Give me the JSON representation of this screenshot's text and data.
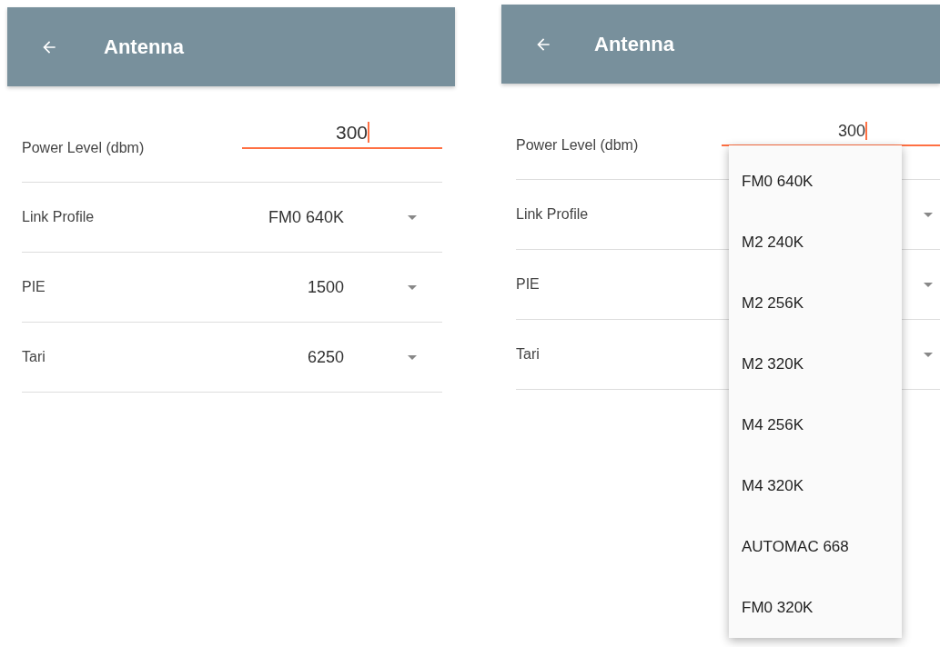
{
  "screens": [
    {
      "title": "Antenna",
      "fields": [
        {
          "kind": "input",
          "label": "Power Level (dbm)",
          "value": "300"
        },
        {
          "kind": "dropdown",
          "label": "Link Profile",
          "value": "FM0 640K"
        },
        {
          "kind": "dropdown",
          "label": "PIE",
          "value": "1500"
        },
        {
          "kind": "dropdown",
          "label": "Tari",
          "value": "6250"
        }
      ]
    },
    {
      "title": "Antenna",
      "fields": [
        {
          "kind": "input",
          "label": "Power Level (dbm)",
          "value": "300"
        },
        {
          "kind": "dropdown",
          "label": "Link Profile"
        },
        {
          "kind": "dropdown",
          "label": "PIE"
        },
        {
          "kind": "dropdown",
          "label": "Tari"
        }
      ],
      "menu": {
        "items": [
          {
            "label": "FM0 640K"
          },
          {
            "label": "M2 240K"
          },
          {
            "label": "M2 256K"
          },
          {
            "label": "M2 320K"
          },
          {
            "label": "M4 256K"
          },
          {
            "label": "M4 320K"
          },
          {
            "label": "AUTOMAC 668"
          },
          {
            "label": "FM0 320K"
          }
        ]
      }
    }
  ]
}
